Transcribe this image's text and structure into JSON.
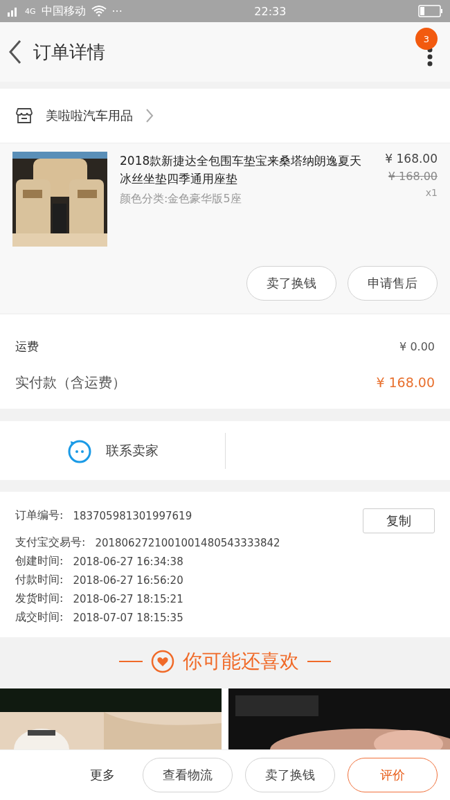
{
  "status_bar": {
    "network": "4G",
    "carrier": "中国移动",
    "dots": "···",
    "time": "22:33"
  },
  "header": {
    "title": "订单详情",
    "badge": "3"
  },
  "shop": {
    "name": "美啦啦汽车用品"
  },
  "product": {
    "title": "2018款新捷达全包围车垫宝来桑塔纳朗逸夏天冰丝坐垫四季通用座垫",
    "price": "¥ 168.00",
    "original_price": "¥ 168.00",
    "variant": "颜色分类:金色豪华版5座",
    "quantity": "x1",
    "actions": [
      "卖了换钱",
      "申请售后"
    ]
  },
  "fees": [
    {
      "label": "运费",
      "value": "¥ 0.00",
      "kind": "plain"
    },
    {
      "label": "实付款（含运费）",
      "value": "¥ 168.00",
      "kind": "total"
    }
  ],
  "contact": {
    "label": "联系卖家"
  },
  "order_info": {
    "copy_button": "复制",
    "rows": [
      {
        "label": "订单编号:",
        "value": "183705981301997619"
      },
      {
        "label": "支付宝交易号:",
        "value": "2018062721001001480543333842"
      },
      {
        "label": "创建时间:",
        "value": "2018-06-27 16:34:38"
      },
      {
        "label": "付款时间:",
        "value": "2018-06-27 16:56:20"
      },
      {
        "label": "发货时间:",
        "value": "2018-06-27 18:15:21"
      },
      {
        "label": "成交时间:",
        "value": "2018-07-07 18:15:35"
      }
    ]
  },
  "recommend": {
    "title": "你可能还喜欢"
  },
  "bottom_bar": {
    "more": "更多",
    "buttons": [
      {
        "label": "查看物流",
        "primary": false
      },
      {
        "label": "卖了换钱",
        "primary": false
      },
      {
        "label": "评价",
        "primary": true
      }
    ]
  }
}
